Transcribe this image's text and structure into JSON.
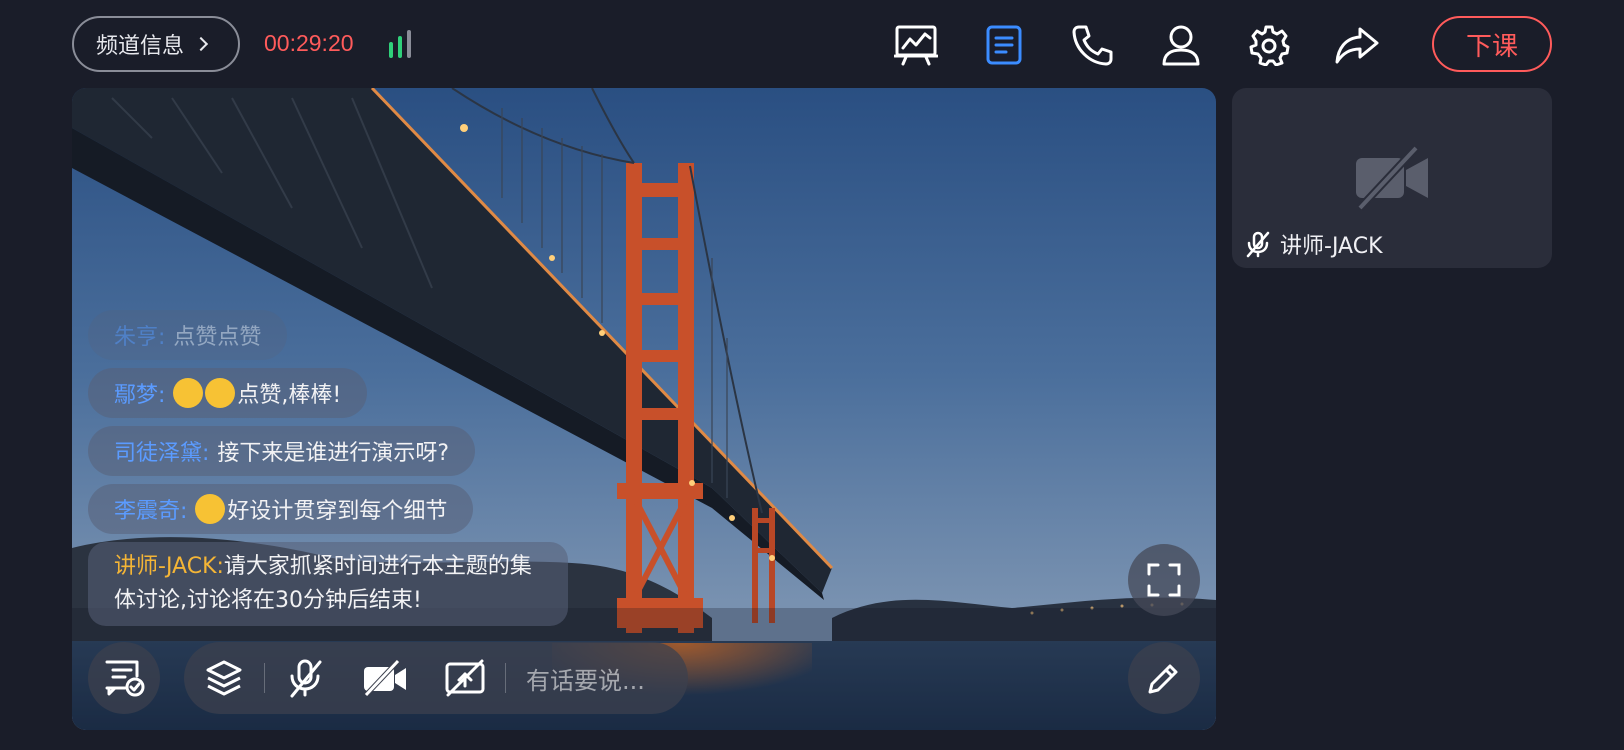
{
  "header": {
    "channel_info_label": "频道信息",
    "timer": "00:29:20",
    "end_class_label": "下课",
    "icons": [
      "whiteboard-icon",
      "document-icon",
      "phone-icon",
      "user-icon",
      "settings-icon",
      "share-icon"
    ],
    "signal_colors": {
      "active": "#2fd07a",
      "inactive": "#8a8d98"
    }
  },
  "chat": {
    "messages": [
      {
        "name": "朱亨:",
        "text": "点赞点赞"
      },
      {
        "name": "鄢梦:",
        "text": "点赞,棒棒!"
      },
      {
        "name": "司徒泽黛:",
        "text": "接下来是谁进行演示呀?"
      },
      {
        "name": "李震奇:",
        "text": "好设计贯穿到每个细节"
      },
      {
        "name": "讲师-JACK:",
        "text": "请大家抓紧时间进行本主题的集体讨论,讨论将在30分钟后结束!"
      }
    ]
  },
  "toolbar": {
    "input_placeholder": "有话要说..."
  },
  "side_tile": {
    "name": "讲师-JACK"
  },
  "colors": {
    "background": "#1a1d29",
    "accent_red": "#ff5b5b",
    "chat_name_blue": "#5b9bff",
    "chat_name_teacher": "#f4b536",
    "active_icon_blue": "#3b8cff"
  }
}
